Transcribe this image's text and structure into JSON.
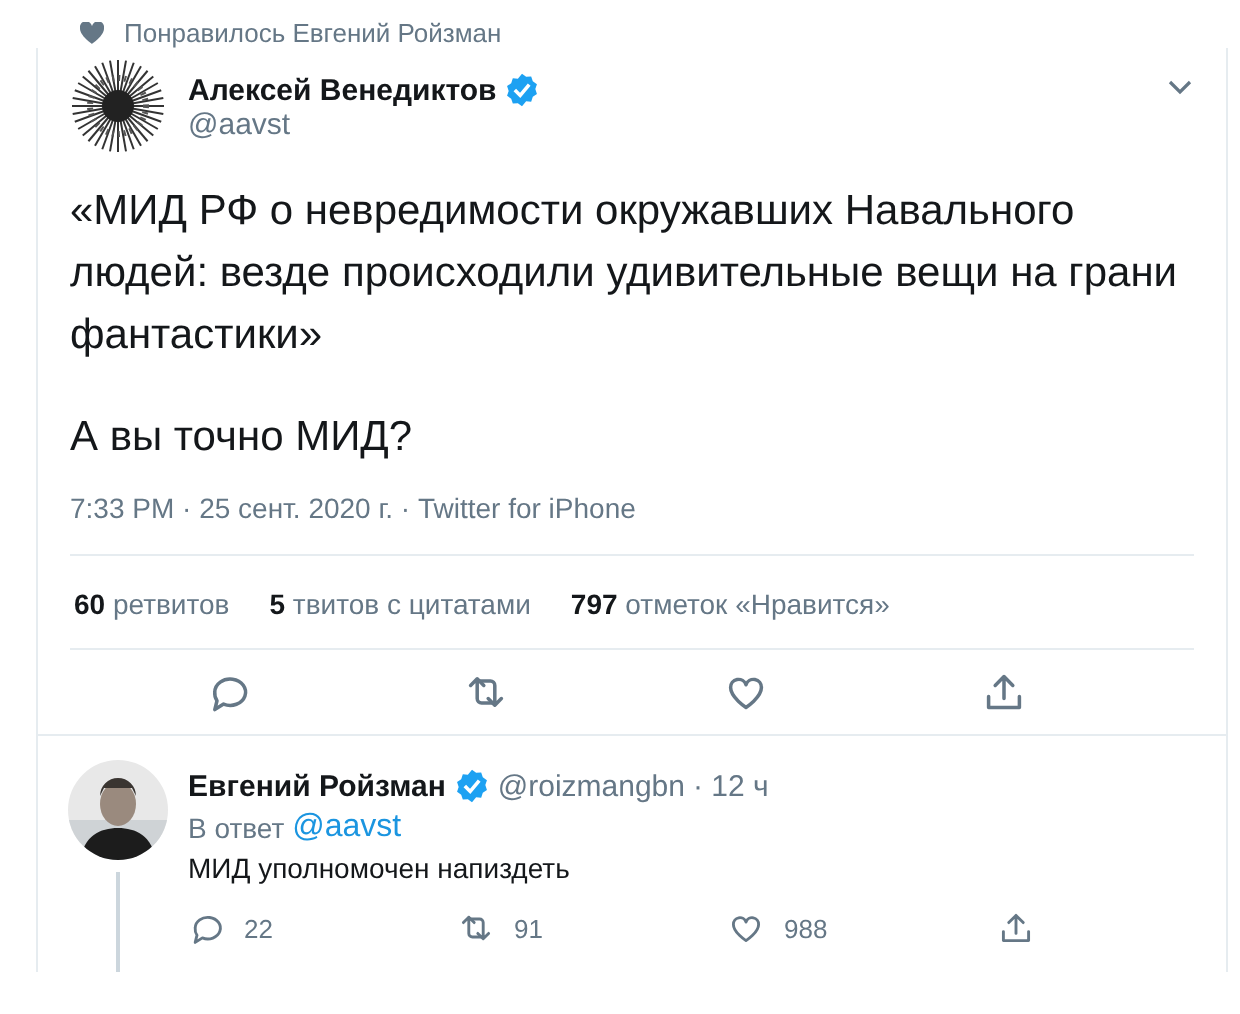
{
  "liked_by": {
    "text": "Понравилось Евгений Ройзман"
  },
  "tweet": {
    "author": {
      "name": "Алексей Венедиктов",
      "handle": "@aavst",
      "verified": true
    },
    "paragraphs": [
      "«МИД РФ о невредимости окружавших Навального людей: везде происходили удивительные вещи на грани фантастики»",
      "А вы точно МИД?"
    ],
    "meta": "7:33 PM · 25 сент. 2020 г. · Twitter for iPhone",
    "stats": [
      {
        "count": "60",
        "label": "ретвитов"
      },
      {
        "count": "5",
        "label": "твитов с цитатами"
      },
      {
        "count": "797",
        "label": "отметок «Нравится»"
      }
    ]
  },
  "reply": {
    "author": {
      "name": "Евгений Ройзман",
      "handle": "@roizmangbn",
      "verified": true
    },
    "time": "· 12 ч",
    "reply_to": {
      "prefix": "В ответ",
      "handle": "@aavst"
    },
    "text": "МИД уполномочен напиздеть",
    "actions": [
      {
        "kind": "reply",
        "count": "22"
      },
      {
        "kind": "retweet",
        "count": "91"
      },
      {
        "kind": "like",
        "count": "988"
      },
      {
        "kind": "share"
      }
    ]
  }
}
